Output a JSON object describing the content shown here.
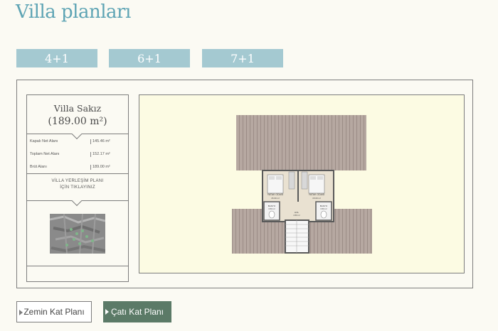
{
  "page": {
    "title": "Villa planları"
  },
  "tabs": [
    {
      "label": "4+1"
    },
    {
      "label": "6+1"
    },
    {
      "label": "7+1"
    }
  ],
  "villa": {
    "name": "Villa Sakız",
    "size": "(189.00 m²)",
    "areas": [
      {
        "label": "Kapalı Net Alanı",
        "value": "145.46 m²"
      },
      {
        "label": "Toplam Net Alanı",
        "value": "152.17 m²"
      },
      {
        "label": "Brüt Alanı",
        "value": "189.00 m²"
      }
    ],
    "layout_link_line1": "VİLLA YERLEŞİM PLANI",
    "layout_link_line2": "İÇİN TIKLAYINIZ"
  },
  "plan": {
    "rooms": [
      {
        "label": "YATAK ODASI",
        "sub": "15.00 m²"
      },
      {
        "label": "YATAK ODASI",
        "sub": "15.00 m²"
      },
      {
        "label": "BANYO",
        "sub": "3.50 m²"
      },
      {
        "label": "BANYO",
        "sub": "3.50 m²"
      },
      {
        "label": "HOL",
        "sub": "4.50 m²"
      }
    ]
  },
  "floors": {
    "ground_label": "Zemin Kat Planı",
    "roof_label": "Çatı Kat Planı"
  },
  "colors": {
    "title": "#5ea4b4",
    "tab_bg": "#a4c9d1",
    "roof_btn_bg": "#5b7a67",
    "plan_bg": "#fcfbe3",
    "roof_tile": "#b4a6a0"
  }
}
